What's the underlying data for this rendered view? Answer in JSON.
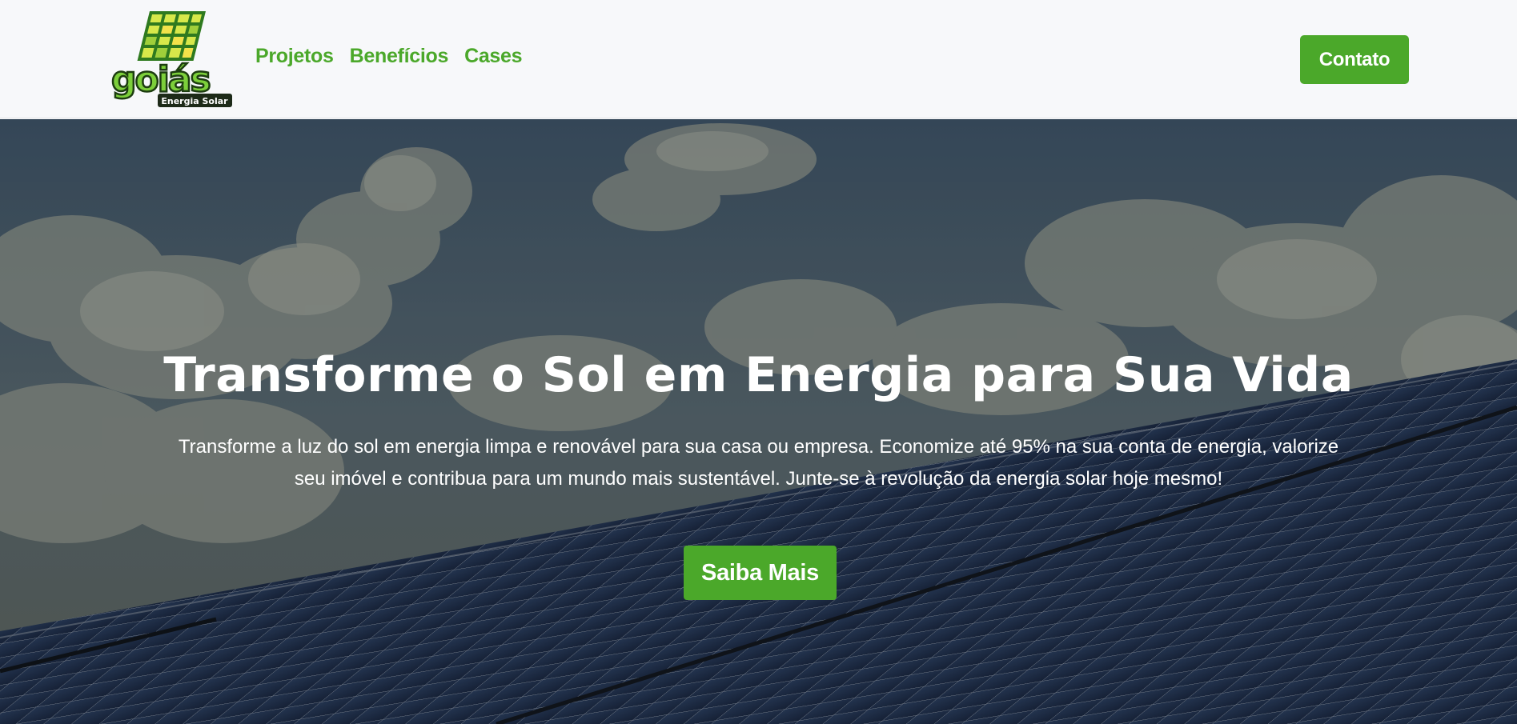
{
  "brand": {
    "logo_text": "goiás",
    "logo_subtext": "Energia Solar",
    "accent_color": "#4ba82a"
  },
  "nav": {
    "items": [
      {
        "label": "Projetos"
      },
      {
        "label": "Benefícios"
      },
      {
        "label": "Cases"
      }
    ],
    "contact_label": "Contato"
  },
  "hero": {
    "title": "Transforme o Sol em Energia para Sua Vida",
    "text": "Transforme a luz do sol em energia limpa e renovável para sua casa ou empresa. Economize até 95% na sua conta de energia, valorize seu imóvel e contribua para um mundo mais sustentável. Junte-se à revolução da energia solar hoje mesmo!",
    "cta_label": "Saiba Mais",
    "background": "sky with clouds over solar panels"
  }
}
